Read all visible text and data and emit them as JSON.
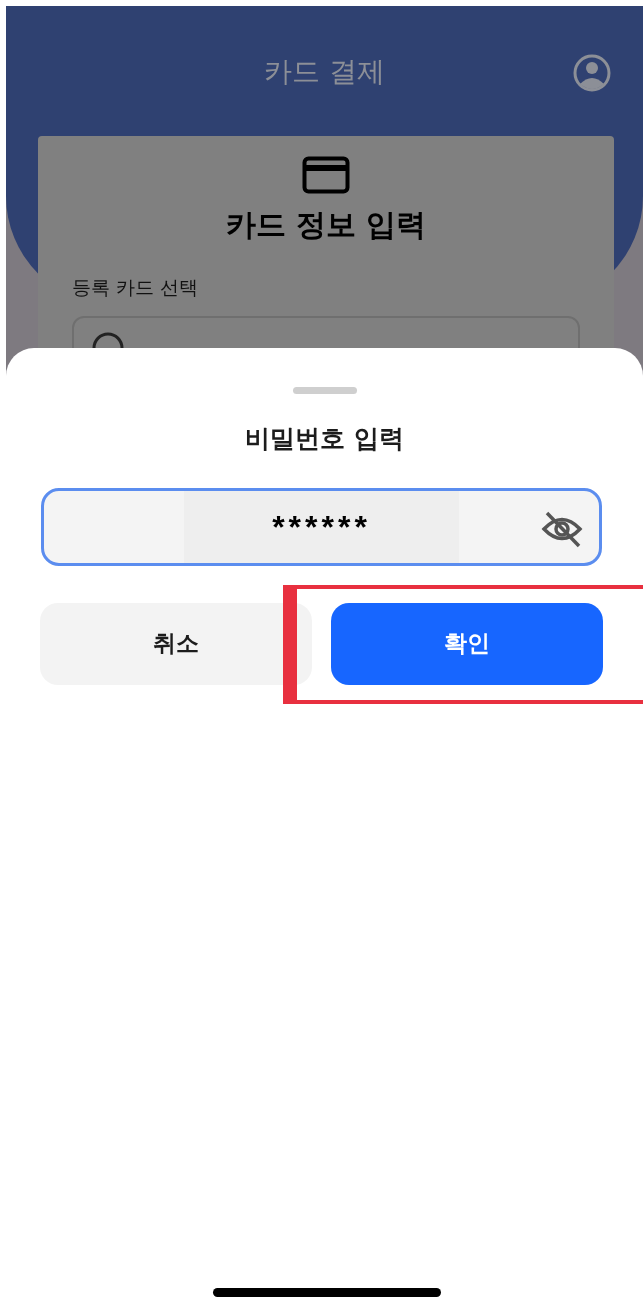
{
  "header": {
    "title": "카드 결제"
  },
  "card_form": {
    "title": "카드 정보 입력",
    "field_label": "등록 카드 선택"
  },
  "sheet": {
    "title": "비밀번호 입력",
    "password": {
      "value": "******",
      "masked": true
    },
    "buttons": [
      {
        "label": "취소",
        "kind": "secondary",
        "highlighted": false
      },
      {
        "label": "확인",
        "kind": "primary",
        "highlighted": true
      }
    ]
  }
}
